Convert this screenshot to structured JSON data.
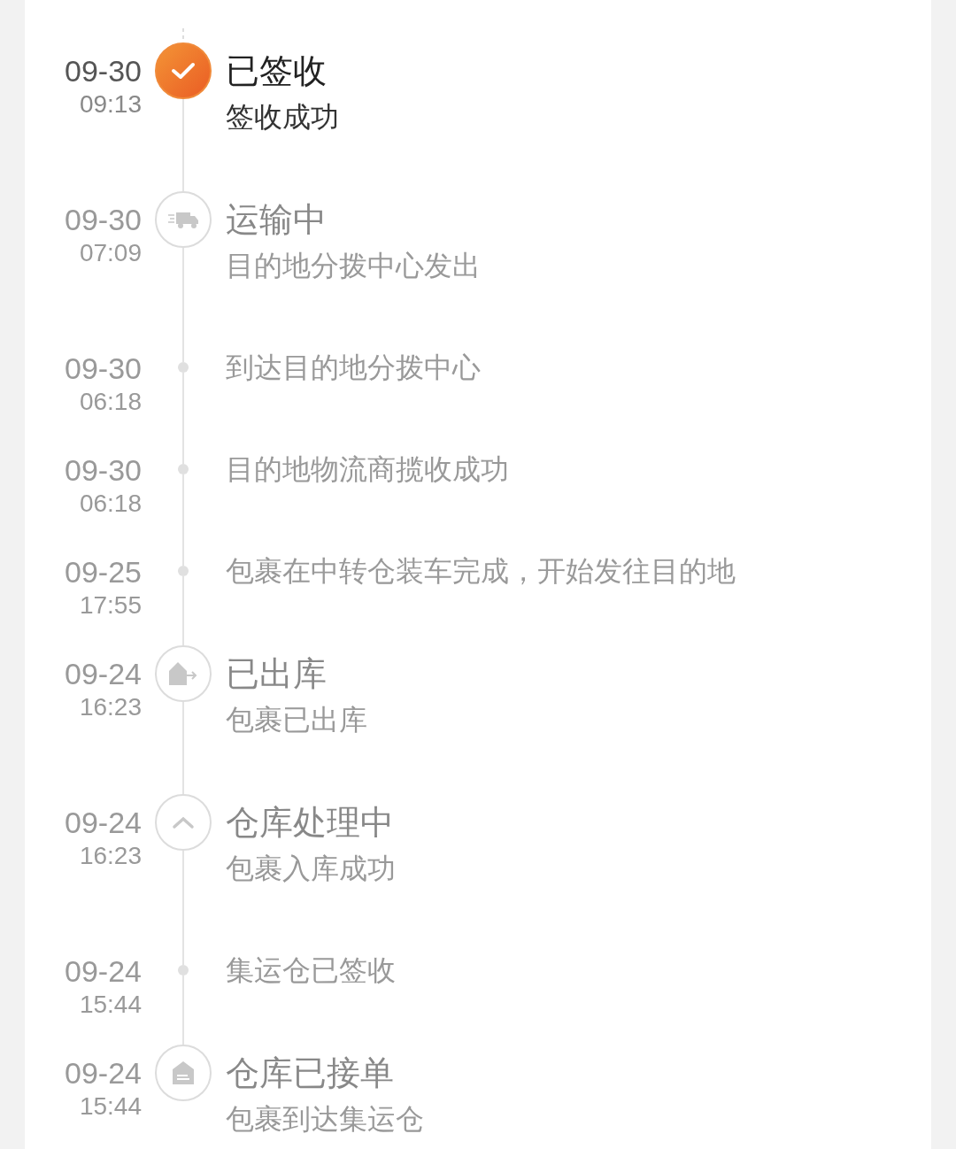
{
  "events": [
    {
      "date": "09-30",
      "time": "09:13",
      "kind": "signed",
      "current": true,
      "title": "已签收",
      "detail": "签收成功"
    },
    {
      "date": "09-30",
      "time": "07:09",
      "kind": "transit",
      "current": false,
      "title": "运输中",
      "detail": "目的地分拨中心发出"
    },
    {
      "date": "09-30",
      "time": "06:18",
      "kind": "step",
      "current": false,
      "text": "到达目的地分拨中心"
    },
    {
      "date": "09-30",
      "time": "06:18",
      "kind": "step",
      "current": false,
      "text": "目的地物流商揽收成功"
    },
    {
      "date": "09-25",
      "time": "17:55",
      "kind": "step",
      "current": false,
      "text": "包裹在中转仓装车完成，开始发往目的地"
    },
    {
      "date": "09-24",
      "time": "16:23",
      "kind": "outbound",
      "current": false,
      "title": "已出库",
      "detail": "包裹已出库"
    },
    {
      "date": "09-24",
      "time": "16:23",
      "kind": "processing",
      "current": false,
      "title": "仓库处理中",
      "detail": "包裹入库成功"
    },
    {
      "date": "09-24",
      "time": "15:44",
      "kind": "step",
      "current": false,
      "text": "集运仓已签收"
    },
    {
      "date": "09-24",
      "time": "15:44",
      "kind": "accepted",
      "current": false,
      "title": "仓库已接单",
      "detail": "包裹到达集运仓"
    }
  ]
}
